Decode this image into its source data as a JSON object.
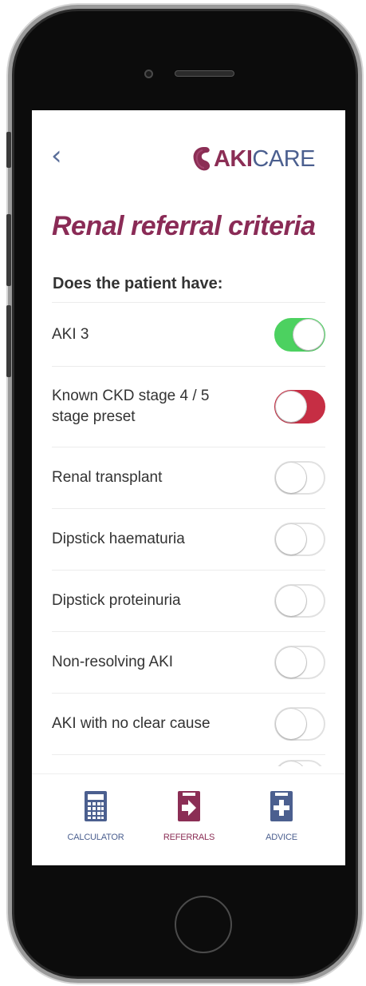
{
  "app": {
    "brand_part1": "AKI",
    "brand_part2": "CARE",
    "back_glyph": "‹"
  },
  "page": {
    "title": "Renal referral criteria",
    "section_heading": "Does the patient have:"
  },
  "criteria": [
    {
      "label": "AKI 3",
      "state": "on",
      "color": "#4cd160"
    },
    {
      "label": "Known CKD stage 4 / 5\nstage preset",
      "state": "on",
      "color": "#c62e44"
    },
    {
      "label": "Renal transplant",
      "state": "off"
    },
    {
      "label": "Dipstick haematuria",
      "state": "off"
    },
    {
      "label": "Dipstick proteinuria",
      "state": "off"
    },
    {
      "label": "Non-resolving AKI",
      "state": "off"
    },
    {
      "label": "AKI with no clear cause",
      "state": "off"
    }
  ],
  "tabbar": {
    "calculator": {
      "label": "CALCULATOR",
      "icon": "calculator-icon",
      "color": "#4b5f8f"
    },
    "referrals": {
      "label": "REFERRALS",
      "icon": "referral-arrow-icon",
      "color": "#8b2e55",
      "active": true
    },
    "advice": {
      "label": "ADVICE",
      "icon": "medical-cross-icon",
      "color": "#4b5f8f"
    }
  },
  "colors": {
    "brand_purple": "#8a2b56",
    "brand_blue": "#4b5f8f",
    "toggle_green": "#4cd160",
    "toggle_red": "#c62e44"
  }
}
